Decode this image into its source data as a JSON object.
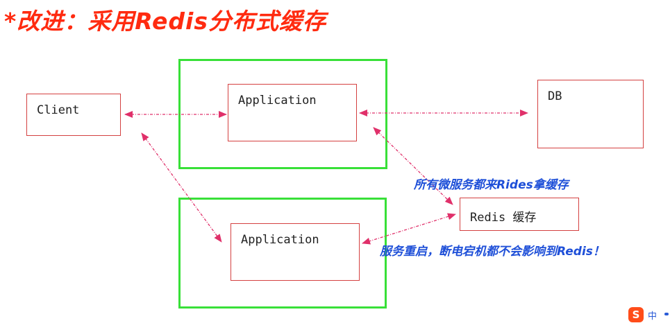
{
  "title": "*改进：采用Redis分布式缓存",
  "nodes": {
    "client": "Client",
    "app_top": "Application",
    "app_bottom": "Application",
    "db": "DB",
    "redis": "Redis 缓存"
  },
  "notes": {
    "all_services": "所有微服务都来Rides拿缓存",
    "restart": "服务重启，断电宕机都不会影响到Redis！"
  },
  "ime": {
    "label": "中"
  },
  "colors": {
    "title": "#ff2b10",
    "note": "#1e4fd8",
    "group_border": "#38e038",
    "box_border": "#d44040",
    "arrow": "#e0306a"
  }
}
